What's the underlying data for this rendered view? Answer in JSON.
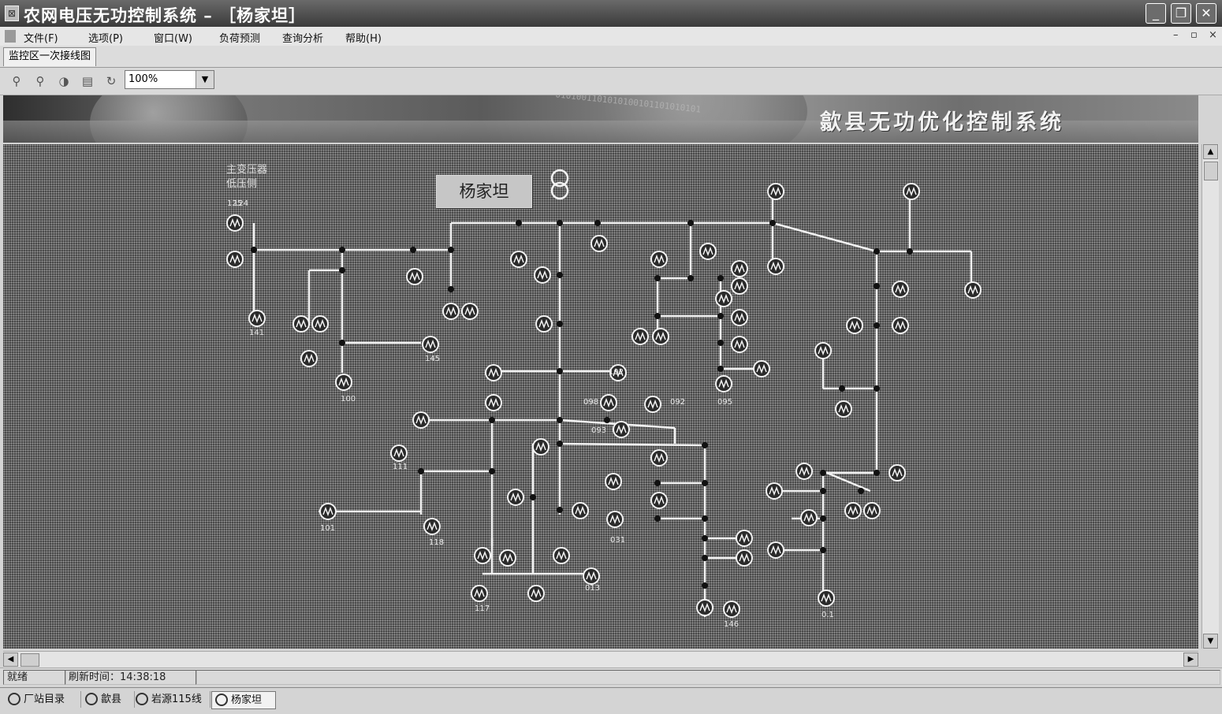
{
  "window": {
    "title": "农网电压无功控制系统 – ［杨家坦］"
  },
  "menu": {
    "items": [
      "文件(F)",
      "选项(P)",
      "窗口(W)",
      "负荷预测",
      "查询分析",
      "帮助(H)"
    ]
  },
  "tab": {
    "label": "监控区一次接线图"
  },
  "toolbar": {
    "zoom_value": "100%"
  },
  "banner": {
    "title": "歙县无功优化控制系统",
    "binary_text": "0101001101010100101101010101"
  },
  "diagram": {
    "station_name": "杨家坦",
    "legend_lines": [
      "主变压器",
      "低压侧"
    ],
    "node_labels": [
      "125",
      "141",
      "145",
      "100",
      "102",
      "098",
      "092",
      "093",
      "095",
      "031",
      "013",
      "111",
      "101",
      "118",
      "117",
      "0.1",
      "146",
      "124"
    ]
  },
  "status": {
    "state": "就绪",
    "refresh_time": "刷新时间：14:38:18"
  },
  "taskbar": {
    "items": [
      "厂站目录",
      "歙县",
      "岩源115线",
      "杨家坦"
    ],
    "active_index": 3
  }
}
